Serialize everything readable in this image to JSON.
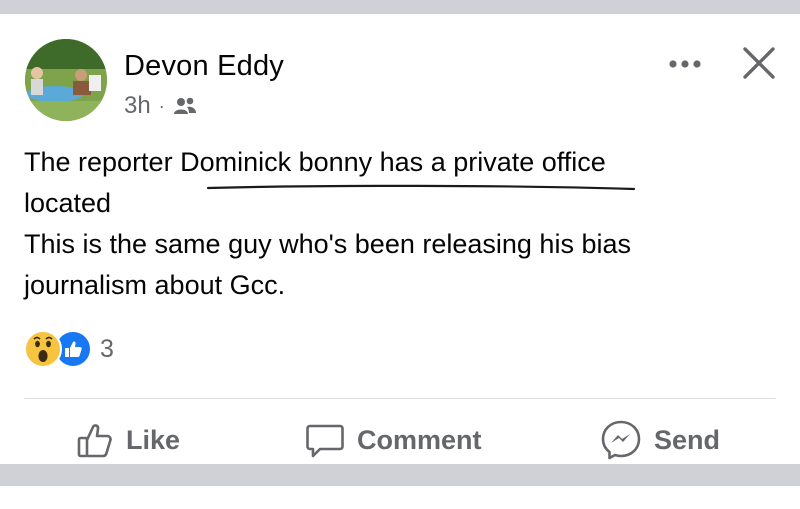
{
  "post": {
    "author": "Devon Eddy",
    "timestamp": "3h",
    "separator": "·",
    "audience_icon": "friends-icon",
    "body_lines": [
      "The reporter Dominick bonny has a private office",
      "located",
      "This is the same guy who's been releasing his bias",
      "journalism about Gcc."
    ],
    "reactions": {
      "types": [
        "wow",
        "like"
      ],
      "count": "3"
    },
    "actions": {
      "like": "Like",
      "comment": "Comment",
      "send": "Send"
    }
  },
  "colors": {
    "text": "#050505",
    "muted": "#65676b",
    "like_blue": "#1877f2",
    "wow_yellow": "#f7c43f",
    "feed_gap": "#cfd1d6"
  }
}
